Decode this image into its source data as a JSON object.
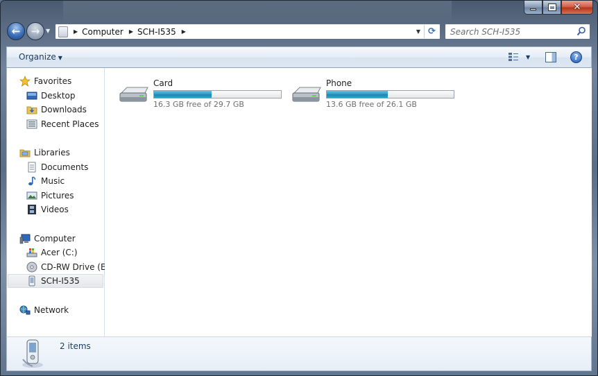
{
  "window": {
    "caption": {
      "minimize": "minimize",
      "maximize": "maximize",
      "close": "close"
    }
  },
  "address_bar": {
    "breadcrumbs": [
      "Computer",
      "SCH-I535"
    ]
  },
  "search": {
    "placeholder": "Search SCH-I535"
  },
  "toolbar": {
    "organize_label": "Organize"
  },
  "nav_pane": {
    "groups": [
      {
        "label": "Favorites",
        "icon": "star-icon",
        "items": [
          {
            "label": "Desktop",
            "icon": "desktop-icon"
          },
          {
            "label": "Downloads",
            "icon": "downloads-folder-icon"
          },
          {
            "label": "Recent Places",
            "icon": "recent-places-icon"
          }
        ]
      },
      {
        "label": "Libraries",
        "icon": "libraries-icon",
        "items": [
          {
            "label": "Documents",
            "icon": "documents-icon"
          },
          {
            "label": "Music",
            "icon": "music-note-icon"
          },
          {
            "label": "Pictures",
            "icon": "pictures-icon"
          },
          {
            "label": "Videos",
            "icon": "video-film-icon"
          }
        ]
      },
      {
        "label": "Computer",
        "icon": "computer-icon",
        "items": [
          {
            "label": "Acer (C:)",
            "icon": "hard-drive-icon"
          },
          {
            "label": "CD-RW Drive (E:)",
            "icon": "cd-drive-icon"
          },
          {
            "label": "SCH-I535",
            "icon": "phone-device-icon",
            "selected": true
          }
        ]
      },
      {
        "label": "Network",
        "icon": "network-icon",
        "items": []
      }
    ]
  },
  "content": {
    "drives": [
      {
        "name": "Card",
        "free_text": "16.3 GB free of 29.7 GB",
        "used_fraction": 0.451
      },
      {
        "name": "Phone",
        "free_text": "13.6 GB free of 26.1 GB",
        "used_fraction": 0.479
      }
    ]
  },
  "details_pane": {
    "count_text": "2 items"
  },
  "colors": {
    "bar_fill": "#2aa0c6",
    "selection": "#e5e7ea",
    "link_text": "#1e3a5c"
  }
}
